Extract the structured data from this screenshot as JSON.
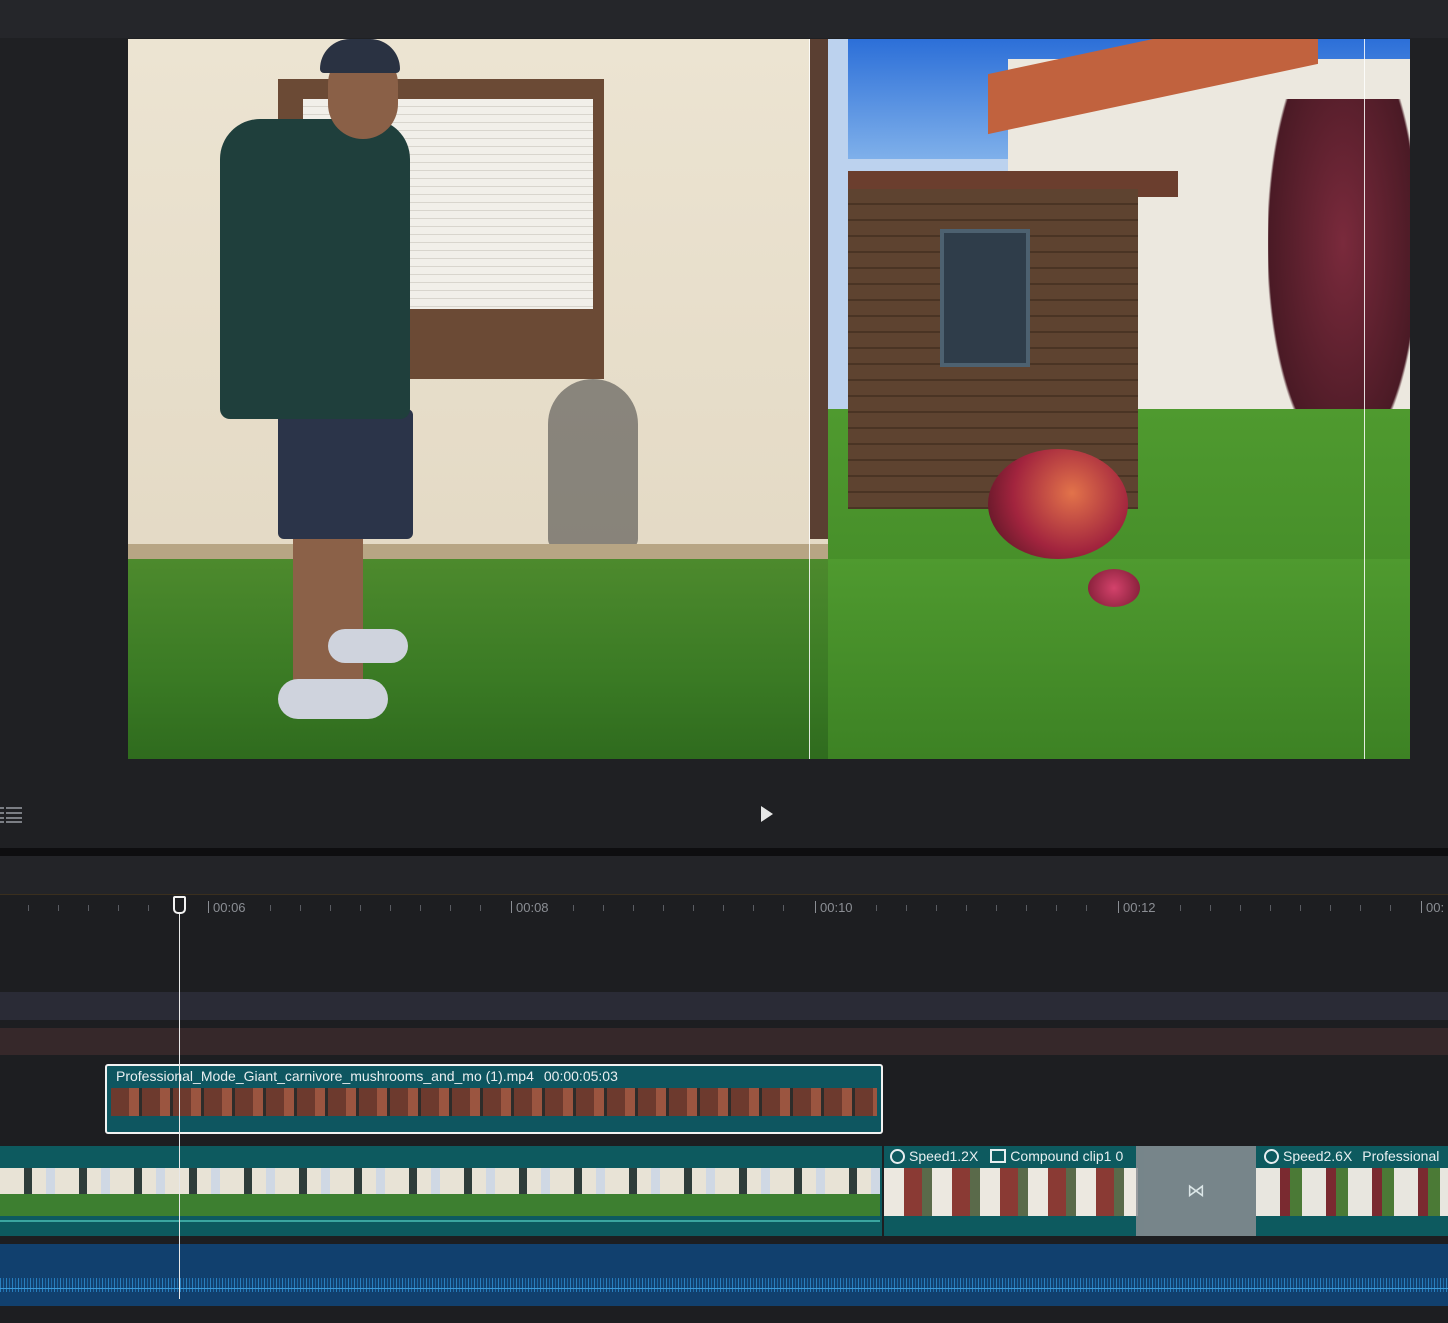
{
  "preview": {
    "play_icon": "play-icon",
    "list_icon": "list-view-icon"
  },
  "timeline": {
    "ruler_labels": [
      "00:06",
      "00:08",
      "00:10",
      "00:12",
      "00:"
    ],
    "selected_clip": {
      "name": "Professional_Mode_Giant_carnivore_mushrooms_and_mo (1).mp4",
      "duration": "00:00:05:03"
    },
    "segment2": {
      "speed": "Speed1.2X",
      "compound": "Compound clip1",
      "extra": "0"
    },
    "segment3": {
      "speed": "Speed2.6X",
      "name": "Professional"
    },
    "transition_icon": "transition-bowtie-icon"
  },
  "colors": {
    "main_track": "#0d5a5f",
    "audio_track": "#11406e",
    "selected_border": "#f2f2f2"
  }
}
